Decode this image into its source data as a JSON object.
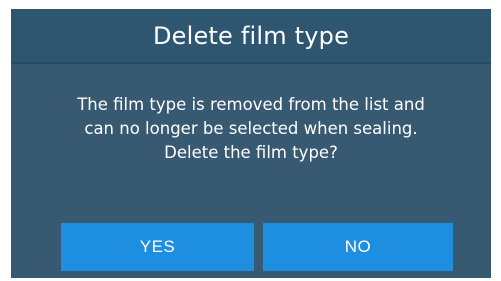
{
  "dialog": {
    "title": "Delete film type",
    "message": [
      "The film type is removed from the list and",
      "can no longer be selected when sealing.",
      "Delete the film type?"
    ],
    "yes_label": "YES",
    "no_label": "NO"
  },
  "colors": {
    "dialog_background": "#375a72",
    "title_background": "#2f5670",
    "button_background": "#1d8ee0",
    "text": "#ffffff"
  }
}
